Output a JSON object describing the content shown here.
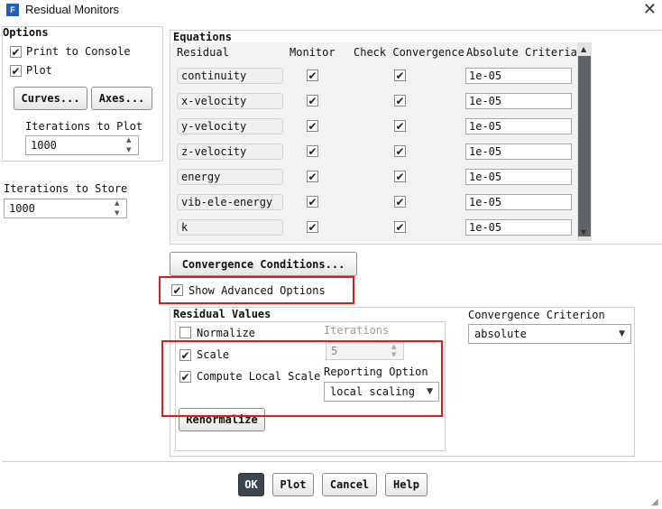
{
  "window": {
    "title": "Residual Monitors",
    "app_icon_letter": "F"
  },
  "options": {
    "title": "Options",
    "print_to_console": {
      "label": "Print to Console",
      "checked": true
    },
    "plot": {
      "label": "Plot",
      "checked": true
    },
    "curves_button": "Curves...",
    "axes_button": "Axes...",
    "iterations_to_plot": {
      "label": "Iterations to Plot",
      "value": "1000"
    }
  },
  "iterations_to_store": {
    "label": "Iterations to Store",
    "value": "1000"
  },
  "equations": {
    "title": "Equations",
    "headers": {
      "residual": "Residual",
      "monitor": "Monitor",
      "check": "Check Convergence",
      "criteria": "Absolute Criteria"
    },
    "rows": [
      {
        "name": "continuity",
        "monitor": true,
        "check": true,
        "criteria": "1e-05"
      },
      {
        "name": "x-velocity",
        "monitor": true,
        "check": true,
        "criteria": "1e-05"
      },
      {
        "name": "y-velocity",
        "monitor": true,
        "check": true,
        "criteria": "1e-05"
      },
      {
        "name": "z-velocity",
        "monitor": true,
        "check": true,
        "criteria": "1e-05"
      },
      {
        "name": "energy",
        "monitor": true,
        "check": true,
        "criteria": "1e-05"
      },
      {
        "name": "vib-ele-energy",
        "monitor": true,
        "check": true,
        "criteria": "1e-05"
      },
      {
        "name": "k",
        "monitor": true,
        "check": true,
        "criteria": "1e-05"
      }
    ]
  },
  "convergence_conditions_button": "Convergence Conditions...",
  "show_advanced": {
    "label": "Show Advanced Options",
    "checked": true
  },
  "residual_values": {
    "title": "Residual Values",
    "normalize": {
      "label": "Normalize",
      "checked": false
    },
    "scale": {
      "label": "Scale",
      "checked": true
    },
    "compute_local_scale": {
      "label": "Compute Local Scale",
      "checked": true
    },
    "iterations": {
      "label": "Iterations",
      "value": "5"
    },
    "reporting_option": {
      "label": "Reporting Option",
      "value": "local scaling"
    },
    "renormalize_button": "Renormalize"
  },
  "convergence_criterion": {
    "label": "Convergence Criterion",
    "value": "absolute"
  },
  "footer": {
    "ok": "OK",
    "plot": "Plot",
    "cancel": "Cancel",
    "help": "Help"
  },
  "colors": {
    "highlight": "#e01b1b",
    "ok_button": "#3d4650",
    "scrollbar_thumb": "#5f6368"
  },
  "check_glyph": "✔"
}
